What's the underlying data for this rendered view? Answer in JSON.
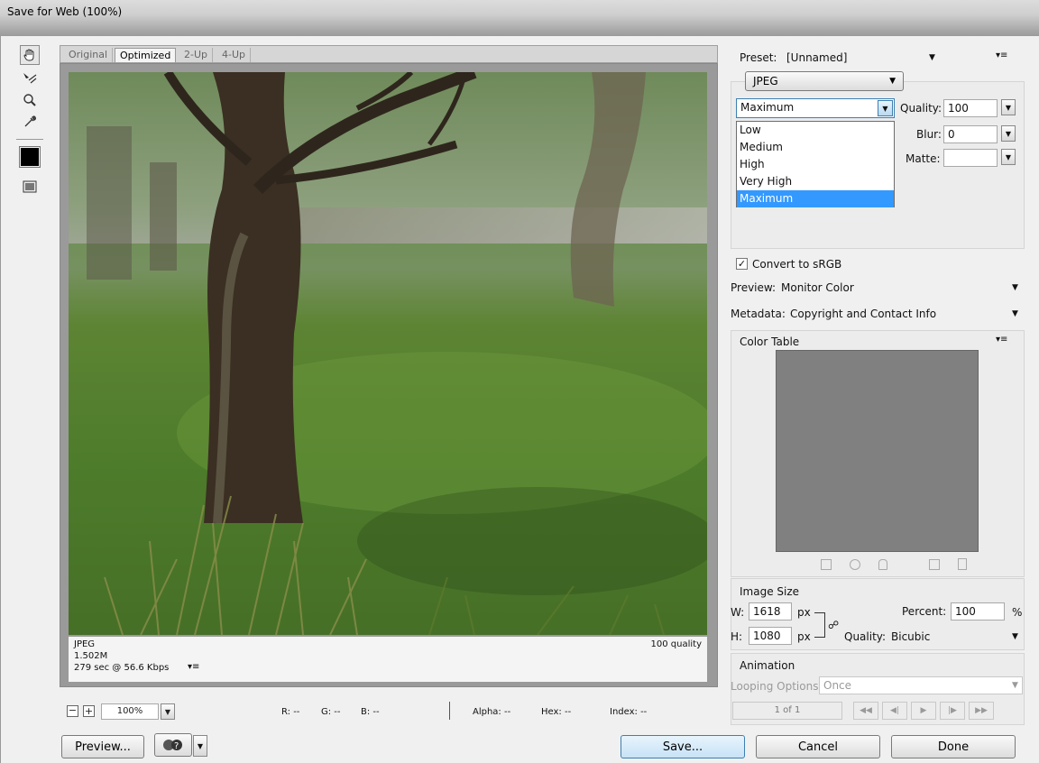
{
  "window": {
    "title": "Save for Web (100%)"
  },
  "tabs": [
    "Original",
    "Optimized",
    "2-Up",
    "4-Up"
  ],
  "preview_info": {
    "format": "JPEG",
    "size": "1.502M",
    "speed": "279 sec @ 56.6 Kbps",
    "quality_label": "100 quality"
  },
  "status": {
    "zoom": "100%",
    "r": "R: --",
    "g": "G: --",
    "b": "B: --",
    "alpha": "Alpha: --",
    "hex": "Hex: --",
    "index": "Index: --"
  },
  "settings": {
    "preset_label": "Preset:",
    "preset_value": "[Unnamed]",
    "format_value": "JPEG",
    "compression_value": "Maximum",
    "compression_options": [
      "Low",
      "Medium",
      "High",
      "Very High",
      "Maximum"
    ],
    "quality_label": "Quality:",
    "quality_value": "100",
    "blur_label": "Blur:",
    "blur_value": "0",
    "matte_label": "Matte:",
    "matte_value": "",
    "convert_srgb_label": "Convert to sRGB",
    "convert_srgb_checked": true,
    "preview_label": "Preview:",
    "preview_value": "Monitor Color",
    "metadata_label": "Metadata:",
    "metadata_value": "Copyright and Contact Info"
  },
  "color_table": {
    "label": "Color Table"
  },
  "image_size": {
    "label": "Image Size",
    "w_label": "W:",
    "w_value": "1618",
    "h_label": "H:",
    "h_value": "1080",
    "unit": "px",
    "percent_label": "Percent:",
    "percent_value": "100",
    "percent_unit": "%",
    "quality_label": "Quality:",
    "quality_value": "Bicubic"
  },
  "animation": {
    "label": "Animation",
    "looping_label": "Looping Options:",
    "looping_value": "Once",
    "frame_counter": "1 of 1"
  },
  "buttons": {
    "preview": "Preview...",
    "save": "Save...",
    "cancel": "Cancel",
    "done": "Done"
  },
  "colors": {
    "accent": "#3399ff",
    "swatch": "#000000"
  }
}
